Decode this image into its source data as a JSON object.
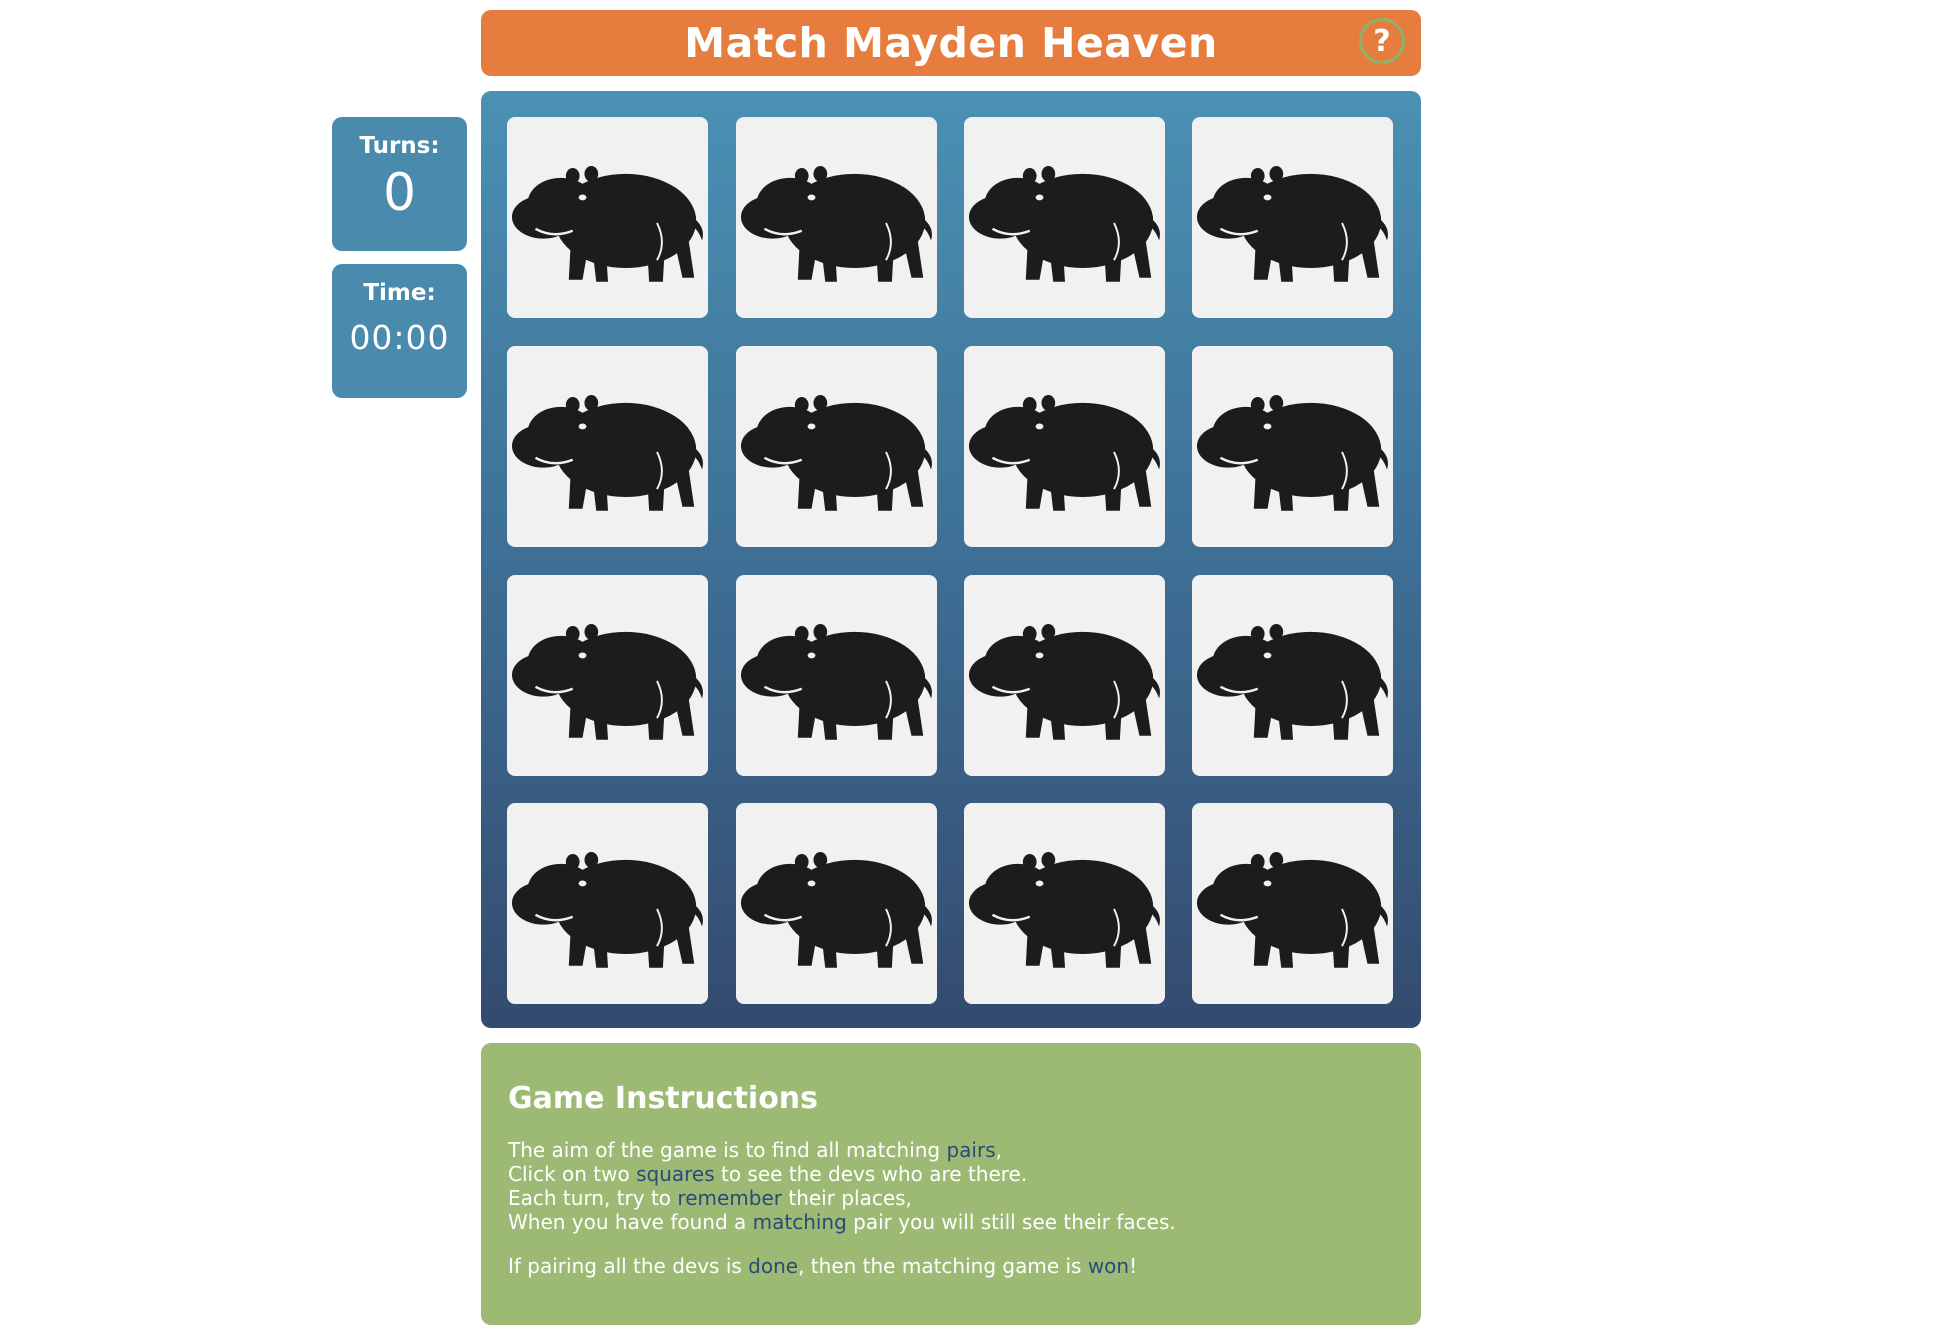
{
  "header": {
    "title": "Match Mayden Heaven",
    "help_label": "?"
  },
  "stats": {
    "turns_label": "Turns:",
    "turns_value": "0",
    "time_label": "Time:",
    "time_value": "00:00"
  },
  "board": {
    "rows": 4,
    "cols": 4,
    "card_back_icon": "hippo-icon",
    "cards": [
      "hippo",
      "hippo",
      "hippo",
      "hippo",
      "hippo",
      "hippo",
      "hippo",
      "hippo",
      "hippo",
      "hippo",
      "hippo",
      "hippo",
      "hippo",
      "hippo",
      "hippo",
      "hippo"
    ]
  },
  "instructions": {
    "title": "Game Instructions",
    "line1": {
      "a": "The aim of the game is to find all matching ",
      "b": "pairs",
      "c": ","
    },
    "line2": {
      "a": "Click on two ",
      "b": "squares",
      "c": " to see the devs who are there."
    },
    "line3": {
      "a": "Each turn, try to ",
      "b": "remember",
      "c": " their places,"
    },
    "line4": {
      "a": "When you have found a ",
      "b": "matching",
      "c": " pair you will still see their faces."
    },
    "line5": {
      "a": "If pairing all the devs is ",
      "b": "done",
      "c": ", then the matching game is ",
      "d": "won",
      "e": "!"
    }
  },
  "colors": {
    "title_bar": "#e67c3e",
    "stat_box": "#4a8aad",
    "board_top": "#4a91b3",
    "board_bottom": "#344a6e",
    "card": "#f1f1f1",
    "instructions_bg": "#9dba74",
    "highlight": "#2b4a78"
  }
}
